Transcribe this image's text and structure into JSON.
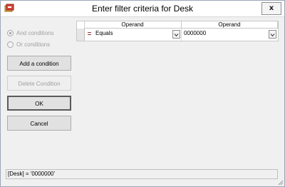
{
  "window": {
    "title": "Enter filter criteria for Desk",
    "close_glyph": "x"
  },
  "options": {
    "and_conditions": "And conditions",
    "or_conditions": "Or conditions",
    "selected": "and_conditions",
    "enabled": false
  },
  "buttons": {
    "add_condition": "Add a condition",
    "delete_condition": "Delete Condition",
    "ok": "OK",
    "cancel": "Cancel"
  },
  "grid": {
    "columns": [
      "Operand",
      "Operand"
    ],
    "rows": [
      {
        "operator": "Equals",
        "value": "0000000"
      }
    ]
  },
  "status": {
    "filter_expression": "[Desk] = '0000000'"
  },
  "icons": {
    "app": "app-icon",
    "close": "close-icon",
    "dropdown": "chevron-down-icon",
    "equals": "equals-operator-icon",
    "grip": "resize-grip-icon"
  }
}
